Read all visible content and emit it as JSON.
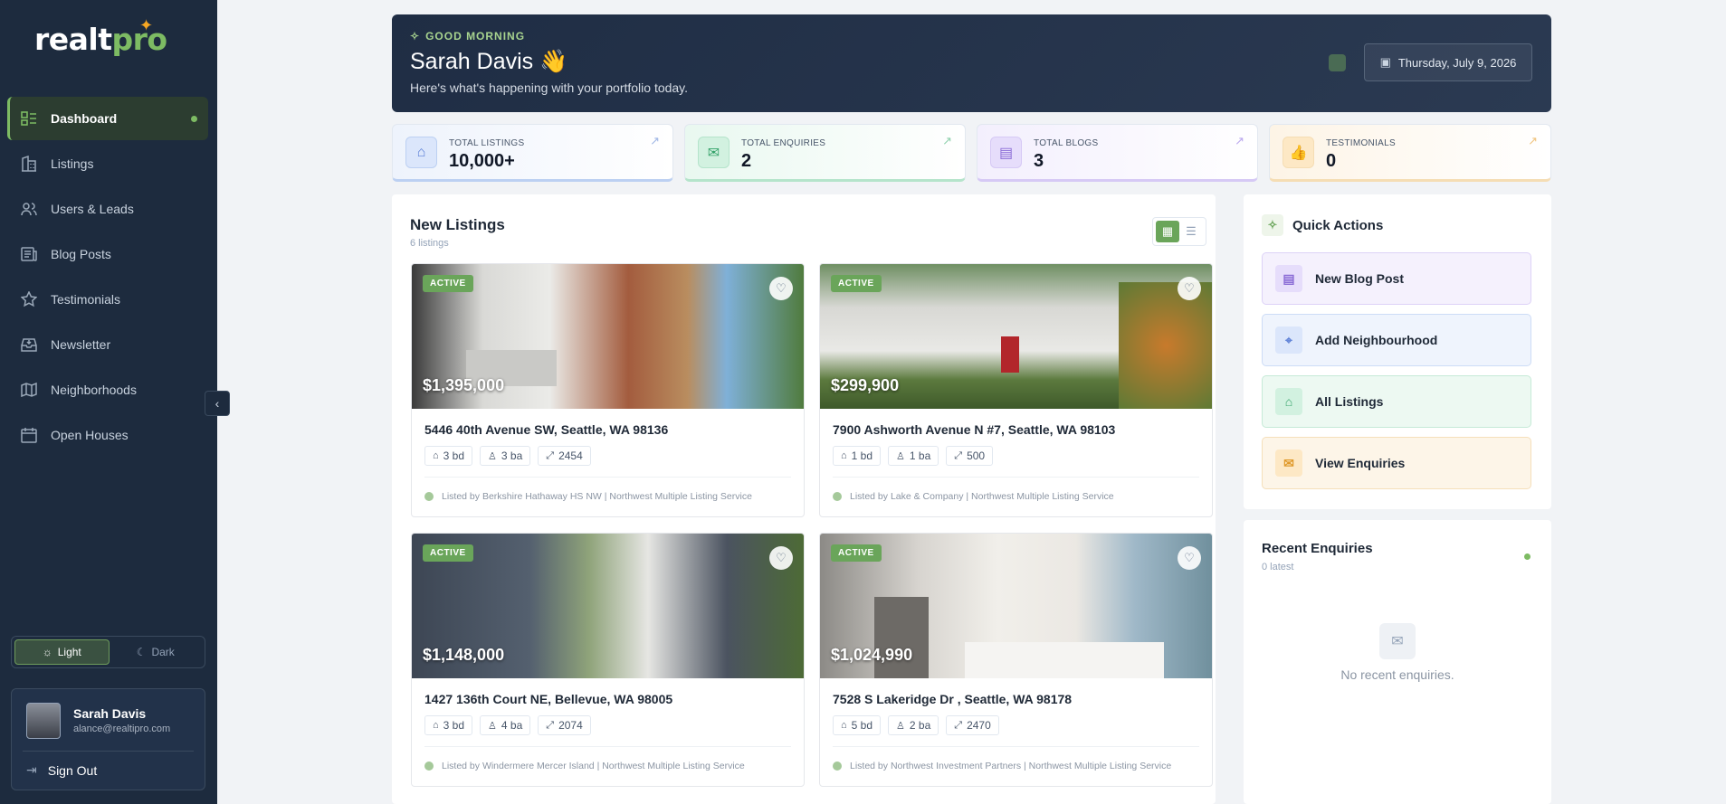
{
  "brand": {
    "name_a": "realt",
    "name_b": "pro"
  },
  "sidebar": {
    "items": [
      {
        "label": "Dashboard"
      },
      {
        "label": "Listings"
      },
      {
        "label": "Users & Leads"
      },
      {
        "label": "Blog Posts"
      },
      {
        "label": "Testimonials"
      },
      {
        "label": "Newsletter"
      },
      {
        "label": "Neighborhoods"
      },
      {
        "label": "Open Houses"
      }
    ],
    "theme": {
      "light": "Light",
      "dark": "Dark"
    },
    "user": {
      "name": "Sarah Davis",
      "email": "alance@realtipro.com"
    },
    "sign_out": "Sign Out"
  },
  "hero": {
    "greeting": "GOOD MORNING",
    "name": "Sarah Davis 👋",
    "subtitle": "Here's what's happening with your portfolio today.",
    "date": "Thursday, July 9, 2026"
  },
  "stats": [
    {
      "label": "TOTAL LISTINGS",
      "value": "10,000+"
    },
    {
      "label": "TOTAL ENQUIRIES",
      "value": "2"
    },
    {
      "label": "TOTAL BLOGS",
      "value": "3"
    },
    {
      "label": "TESTIMONIALS",
      "value": "0"
    }
  ],
  "new_listings": {
    "title": "New Listings",
    "count": "6 listings",
    "cards": [
      {
        "status": "ACTIVE",
        "price": "$1,395,000",
        "address": "5446 40th Avenue SW, Seattle, WA 98136",
        "beds": "3 bd",
        "baths": "3 ba",
        "sqft": "2454",
        "listed_by": "Listed by Berkshire Hathaway HS NW | Northwest Multiple Listing Service"
      },
      {
        "status": "ACTIVE",
        "price": "$299,900",
        "address": "7900 Ashworth Avenue N #7, Seattle, WA 98103",
        "beds": "1 bd",
        "baths": "1 ba",
        "sqft": "500",
        "listed_by": "Listed by Lake & Company | Northwest Multiple Listing Service"
      },
      {
        "status": "ACTIVE",
        "price": "$1,148,000",
        "address": "1427 136th Court NE, Bellevue, WA 98005",
        "beds": "3 bd",
        "baths": "4 ba",
        "sqft": "2074",
        "listed_by": "Listed by Windermere Mercer Island | Northwest Multiple Listing Service"
      },
      {
        "status": "ACTIVE",
        "price": "$1,024,990",
        "address": "7528 S Lakeridge Dr , Seattle, WA 98178",
        "beds": "5 bd",
        "baths": "2 ba",
        "sqft": "2470",
        "listed_by": "Listed by Northwest Investment Partners | Northwest Multiple Listing Service"
      }
    ]
  },
  "quick_actions": {
    "title": "Quick Actions",
    "items": [
      {
        "label": "New Blog Post"
      },
      {
        "label": "Add Neighbourhood"
      },
      {
        "label": "All Listings"
      },
      {
        "label": "View Enquiries"
      }
    ]
  },
  "recent_enquiries": {
    "title": "Recent Enquiries",
    "count": "0 latest",
    "empty": "No recent enquiries."
  },
  "colors": {
    "accent": "#6aa55a",
    "sidebar": "#1d2b3e",
    "hero": "#1f2d44"
  }
}
